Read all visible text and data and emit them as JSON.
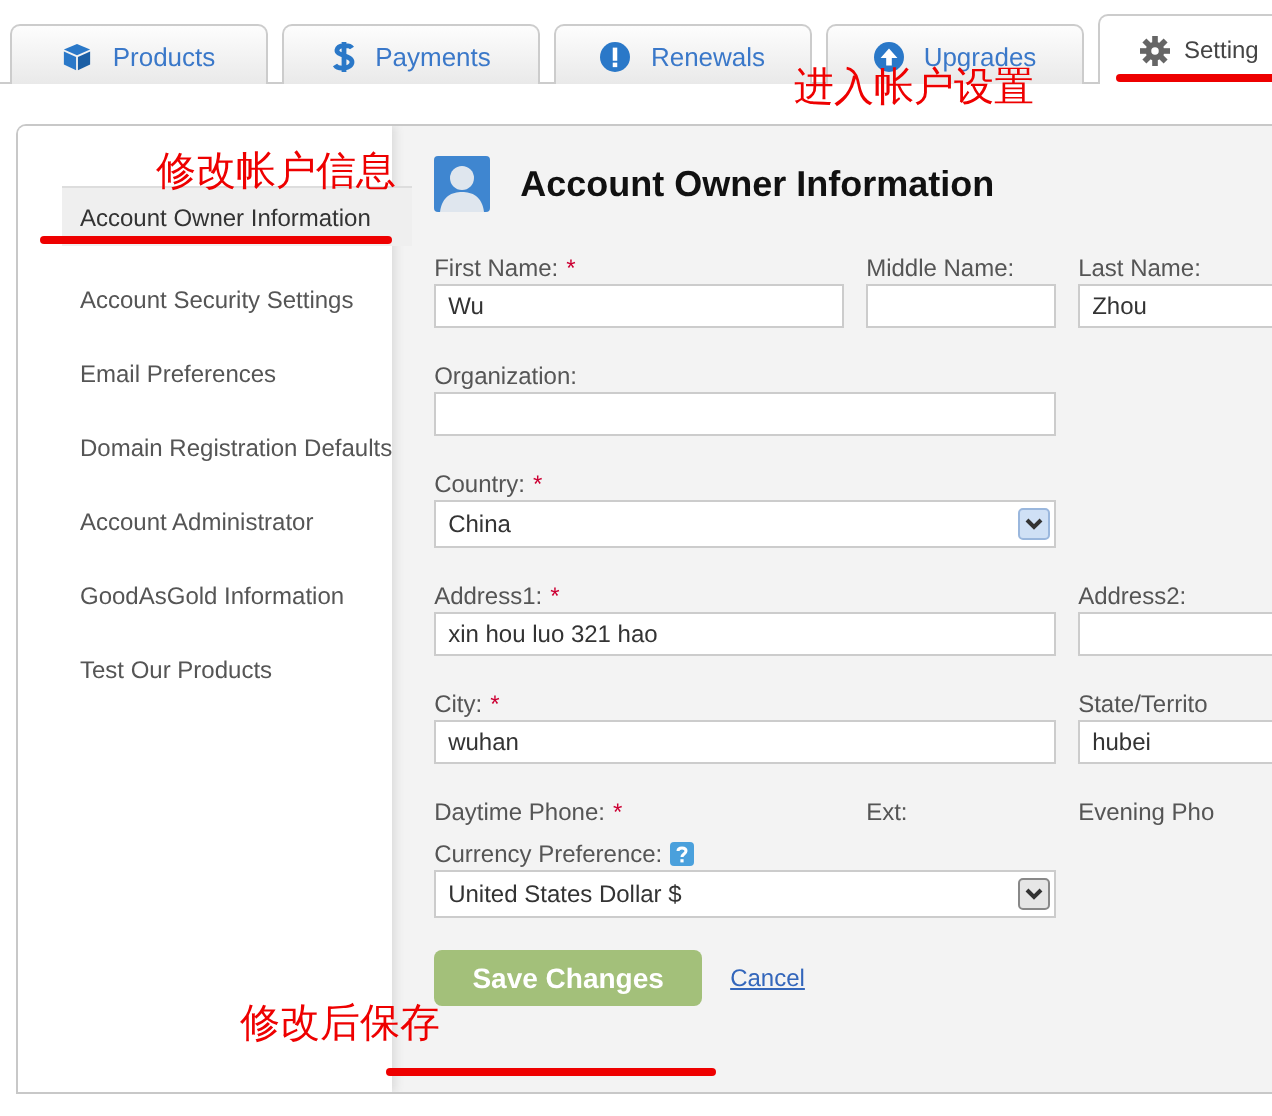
{
  "tabs": [
    {
      "label": "Products",
      "selected": false
    },
    {
      "label": "Payments",
      "selected": false
    },
    {
      "label": "Renewals",
      "selected": false
    },
    {
      "label": "Upgrades",
      "selected": false
    },
    {
      "label": "Setting",
      "selected": true
    }
  ],
  "sidebar": {
    "items": [
      {
        "label": "Account Owner Information",
        "selected": true
      },
      {
        "label": "Account Security Settings",
        "selected": false
      },
      {
        "label": "Email Preferences",
        "selected": false
      },
      {
        "label": "Domain Registration Defaults",
        "selected": false
      },
      {
        "label": "Account Administrator",
        "selected": false
      },
      {
        "label": "GoodAsGold Information",
        "selected": false
      },
      {
        "label": "Test Our Products",
        "selected": false
      }
    ]
  },
  "content": {
    "title": "Account Owner Information",
    "rows": [
      [
        {
          "label": "First Name:",
          "required_mark": "*",
          "kind": "text",
          "value": "Wu"
        },
        {
          "label": "Middle Name:",
          "kind": "text"
        },
        {
          "label": "Last Name:",
          "kind": "text",
          "value": "Zhou"
        }
      ],
      [
        {
          "label": "Organization:",
          "kind": "text"
        }
      ],
      [
        {
          "label": "Country:",
          "required_mark": "*",
          "kind": "select",
          "value": "China"
        }
      ],
      [
        {
          "label": "Address1:",
          "required_mark": "*",
          "kind": "text",
          "value": "xin hou luo 321 hao"
        },
        {
          "label": "Address2:",
          "kind": "text"
        }
      ],
      [
        {
          "label": "City:",
          "required_mark": "*",
          "kind": "text",
          "value": "wuhan"
        },
        {
          "label": "State/Territo",
          "kind": "text",
          "value": "hubei"
        }
      ],
      [
        {
          "label": "Daytime Phone:",
          "required_mark": "*",
          "kind": "label"
        },
        {
          "label": "Ext:",
          "kind": "label"
        },
        {
          "label": "Evening Pho",
          "kind": "label"
        }
      ],
      [
        {
          "label": "Currency Preference:",
          "help": true,
          "kind": "select",
          "value": "United States Dollar $"
        }
      ]
    ],
    "save": {
      "label": "Save Changes",
      "disabled": true
    },
    "cancel": "Cancel"
  },
  "annotations": [
    {
      "text": "进入帐户设置"
    },
    {
      "text": "修改帐户信息"
    },
    {
      "text": "修改后保存"
    }
  ]
}
